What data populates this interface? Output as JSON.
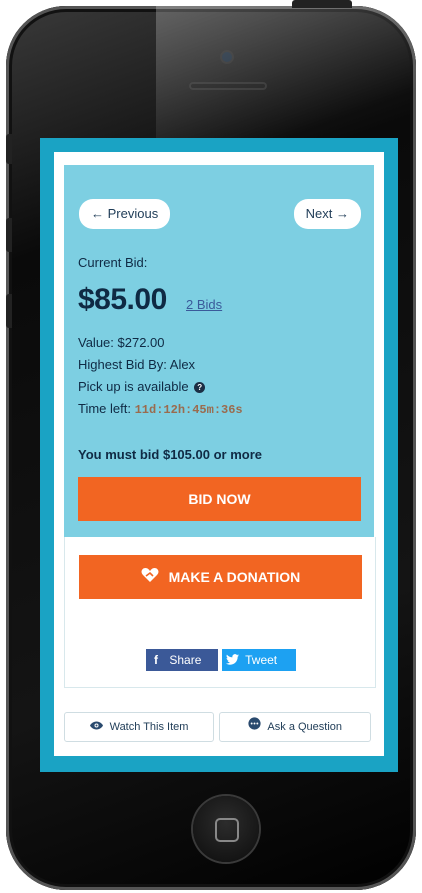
{
  "nav": {
    "prev_label": "← Previous",
    "next_label": "Next →"
  },
  "auction": {
    "current_bid_label": "Current Bid:",
    "current_bid": "$85.00",
    "bids_link": "2 Bids",
    "value_line": "Value: $272.00",
    "highest_line": "Highest Bid By: Alex",
    "pickup_line": "Pick up is available",
    "time_left_label": "Time left:",
    "time_left": "11d:12h:45m:36s",
    "min_bid_note": "You must bid $105.00 or more",
    "bid_button": "BID NOW"
  },
  "donation": {
    "button": "MAKE A DONATION"
  },
  "share": {
    "facebook": "Share",
    "twitter": "Tweet"
  },
  "footer": {
    "watch": "Watch This Item",
    "ask": "Ask a Question"
  },
  "colors": {
    "frame": "#1aa3c4",
    "panel": "#7dcfe2",
    "accent": "#f26522",
    "facebook": "#3b5998",
    "twitter": "#1da1f2"
  }
}
